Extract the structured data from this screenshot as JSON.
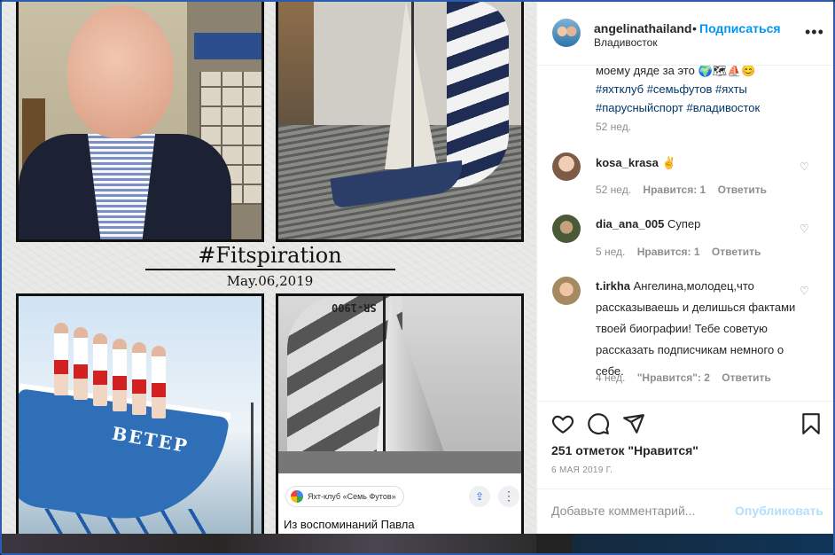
{
  "post": {
    "tagline": "#Fitspiration",
    "date": "May.06,2019",
    "boat_name": "ВЕТЕР",
    "sail_number": "SR-1900",
    "source_chip": "Яхт-клуб «Семь Футов»",
    "caption_below": "Из воспоминаний Павла"
  },
  "header": {
    "username": "angelinathailand",
    "separator": "•",
    "follow_label": "Подписаться",
    "location": "Владивосток",
    "more_glyph": "•••"
  },
  "caption": {
    "text": "моему дяде за это 🌍🗺⛵😊",
    "hashtags": "#яхтклуб #семьфутов #яхты #парусныйспорт #владивосток",
    "age": "52 нед."
  },
  "comments": [
    {
      "username": "kosa_krasa",
      "text": "✌",
      "age": "52 нед.",
      "likes": "Нравится: 1",
      "reply": "Ответить"
    },
    {
      "username": "dia_ana_005",
      "text": "Супер",
      "age": "5 нед.",
      "likes": "Нравится: 1",
      "reply": "Ответить"
    },
    {
      "username": "t.irkha",
      "text": "Ангелина,молодец,что рассказываешь и делишься фактами твоей биографии! Тебе советую рассказать подписчикам немного о себе.",
      "age": "4 нед.",
      "likes": "\"Нравится\": 2",
      "reply": "Ответить"
    }
  ],
  "footer": {
    "likes_count": "251 отметок \"Нравится\"",
    "post_date": "6 МАЯ 2019 Г.",
    "comment_placeholder": "Добавьте комментарий...",
    "publish_label": "Опубликовать"
  },
  "colors": {
    "accent": "#0095f6",
    "publish_disabled": "#b2dffc",
    "hashtag": "#00376b",
    "muted": "#8e8e8e"
  }
}
